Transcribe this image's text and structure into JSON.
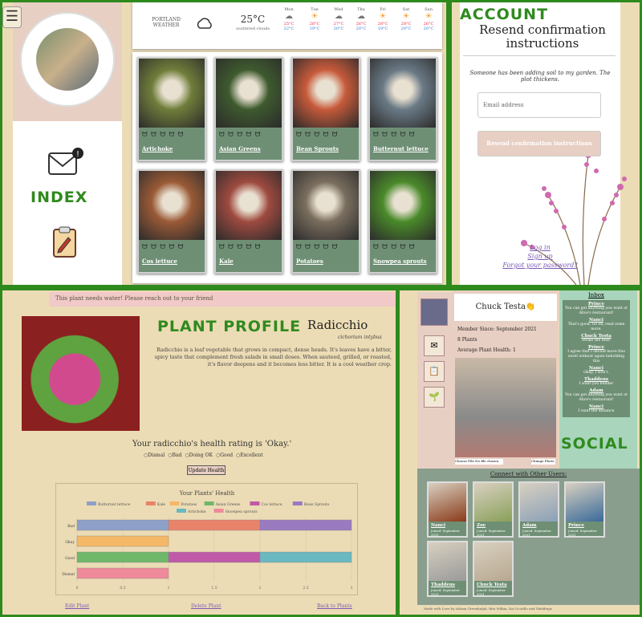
{
  "labels": {
    "index": "INDEX",
    "account": "ACCOUNT",
    "plant": "PLANT PROFILE",
    "social": "SOCIAL"
  },
  "weather": {
    "city": "PORTLAND",
    "sub": "WEATHER",
    "temp": "25°C",
    "desc": "scattered clouds",
    "days": [
      {
        "d": "Mon",
        "hi": "",
        "lo": ""
      },
      {
        "d": "Tue",
        "hi": "28°C",
        "lo": "19°C"
      },
      {
        "d": "Wed",
        "hi": "27°C",
        "lo": "20°C"
      },
      {
        "d": "Thu",
        "hi": "26°C",
        "lo": "20°C"
      },
      {
        "d": "Fri",
        "hi": "28°C",
        "lo": "19°C"
      },
      {
        "d": "Sat",
        "hi": "28°C",
        "lo": "20°C"
      },
      {
        "d": "Sun",
        "hi": "26°C",
        "lo": "20°C"
      }
    ],
    "first_lo": "25°C",
    "first_lo2": "22°C"
  },
  "plants": [
    {
      "name": "Artichoke",
      "stars": "ᗢ ᗢ ᗢ ᗢ ᗢ",
      "color": "#6f7d3a"
    },
    {
      "name": "Asian Greens",
      "stars": "ᗢ ᗢ ᗢ ᗢ ᗢ",
      "color": "#3e5a2e"
    },
    {
      "name": "Bean Sprouts",
      "stars": "ᗢ ᗢ ᗢ ᗢ ᗢ",
      "color": "#c75a3a"
    },
    {
      "name": "Butternut lettuce",
      "stars": "ᗢ ᗢ ᗢ ᗢ ᗢ",
      "color": "#6a7a86"
    },
    {
      "name": "Cos lettuce",
      "stars": "ᗢ ᗢ ᗢ ᗢ ᗢ",
      "color": "#9a5a36"
    },
    {
      "name": "Kale",
      "stars": "ᗢ ᗢ ᗢ ᗢ ᗢ",
      "color": "#9e4a3f"
    },
    {
      "name": "Potatoes",
      "stars": "ᗢ ᗢ ᗢ ᗢ ᗢ",
      "color": "#7a6e5e"
    },
    {
      "name": "Snowpea sprouts",
      "stars": "ᗢ ᗢ ᗢ ᗢ ᗢ",
      "color": "#4a8a2a"
    }
  ],
  "account": {
    "title": "Resend confirmation instructions",
    "subtitle": "Someone has been adding soil to my garden. The plot thickens.",
    "placeholder": "Email address",
    "button": "Resend confirmation instructions",
    "login": "Log in",
    "signup": "Sign up",
    "forgot": "Forgot your password?"
  },
  "plant": {
    "banner": "This plant needs water! Please reach out to your friend",
    "name": "Radicchio",
    "sci": "cichorium intybus",
    "desc": "Radicchio is a leaf vegetable that grows in compact, dense heads. It's leaves have a bitter, spicy taste that complement fresh salads in small doses. When sauteed, grilled, or roasted, it's flavor deepens and it becomes less bitter. It is a cool weather crop.",
    "rating": "Your radicchio's health rating is 'Okay.'",
    "options": [
      "Dismal",
      "Bad",
      "Doing OK",
      "Good",
      "Excellent"
    ],
    "update": "Update Health",
    "edit": "Edit Plant",
    "delete": "Delete Plant",
    "back": "Back to Plants"
  },
  "chart_data": {
    "type": "bar",
    "title": "Your Plants' Health",
    "orientation": "horizontal",
    "stacked": true,
    "categories": [
      "Bad",
      "Okay",
      "Good",
      "Dismal"
    ],
    "series": [
      {
        "name": "Butternut lettuce",
        "color": "#8fa0c8",
        "values": [
          1,
          0,
          0,
          0
        ]
      },
      {
        "name": "Kale",
        "color": "#e8836a",
        "values": [
          1,
          0,
          0,
          0
        ]
      },
      {
        "name": "Potatoes",
        "color": "#f5b866",
        "values": [
          0,
          1,
          0,
          0
        ]
      },
      {
        "name": "Asian Greens",
        "color": "#6fb86a",
        "values": [
          0,
          0,
          1,
          0
        ]
      },
      {
        "name": "Cos lettuce",
        "color": "#c05aa8",
        "values": [
          0,
          0,
          1,
          0
        ]
      },
      {
        "name": "Bean Sprouts",
        "color": "#9a7ac0",
        "values": [
          1,
          0,
          0,
          0
        ]
      },
      {
        "name": "Artichoke",
        "color": "#6ab8c0",
        "values": [
          0,
          0,
          1,
          0
        ]
      },
      {
        "name": "Snowpea sprouts",
        "color": "#ee8a9a",
        "values": [
          0,
          0,
          0,
          1
        ]
      }
    ],
    "xticks": [
      "0",
      "0.5",
      "1",
      "1.5",
      "2",
      "2.5",
      "3"
    ],
    "xlim": [
      0,
      3
    ]
  },
  "social": {
    "name": "Chuck Testa👏",
    "member": "Member Since: September 2021",
    "plants": "8 Plants",
    "health": "Average Plant Health: 1",
    "choose": "Choose File",
    "nofile": "No file chosen",
    "change": "Change Photo",
    "inbox_title": "Inbox",
    "messages": [
      {
        "from": "Prince",
        "text": "You can get anything you want at Alice's restaurant!"
      },
      {
        "from": "Nanci",
        "text": "That's good. Go on, read some more."
      },
      {
        "from": "Chuck Testa",
        "text": "Strike the tent!"
      },
      {
        "from": "Prince",
        "text": "I agree that I should move this swell without again beholding this"
      },
      {
        "from": "Nanci",
        "text": "Okay, I won't."
      },
      {
        "from": "Thaddeus",
        "text": "I want you bunder"
      },
      {
        "from": "Adam",
        "text": "You can get anything you want at Alice's restaurant!"
      },
      {
        "from": "Nanci",
        "text": "I want the distance"
      }
    ],
    "connect": "Connect with Other Users:",
    "users": [
      {
        "name": "Nanci",
        "joined": "Joined: September 2021",
        "color": "#8a3a1a"
      },
      {
        "name": "Zoe",
        "joined": "Joined: September 2021",
        "color": "#8aa05a"
      },
      {
        "name": "Adam",
        "joined": "Joined: September 2021",
        "color": "#8aa0b8"
      },
      {
        "name": "Prince",
        "joined": "Joined: September 2021",
        "color": "#3a6a9a"
      },
      {
        "name": "Thaddeus",
        "joined": "Joined: September 2021",
        "color": "#9a9a9a"
      },
      {
        "name": "Chuck Testa",
        "joined": "Joined: September 2021",
        "color": "#b8a890"
      }
    ],
    "footer": "Made with Love by Adrian Greenhalgh, Rita Wilkin, Kai Ocotillo and Skiddings"
  }
}
